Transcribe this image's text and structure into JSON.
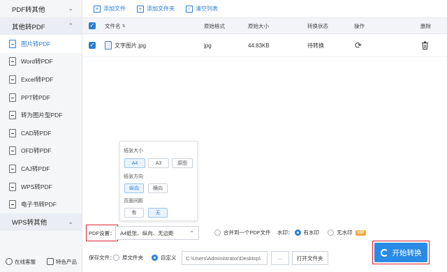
{
  "sidebar": {
    "group1": "PDF转其他",
    "group2": "其他转PDF",
    "group3": "WPS转其他",
    "items": [
      {
        "label": "图片转PDF"
      },
      {
        "label": "Word转PDF"
      },
      {
        "label": "Excel转PDF"
      },
      {
        "label": "PPT转PDF"
      },
      {
        "label": "转为图片型PDF"
      },
      {
        "label": "CAD转PDF"
      },
      {
        "label": "OFD转PDF"
      },
      {
        "label": "CAJ转PDF"
      },
      {
        "label": "WPS转PDF"
      },
      {
        "label": "电子书转PDF"
      }
    ],
    "footer": {
      "service": "在线客服",
      "products": "特色产品"
    }
  },
  "toolbar": {
    "add_file": "添加文件",
    "add_folder": "添加文件夹",
    "clear": "清空列表"
  },
  "table": {
    "headers": {
      "name": "文件名",
      "format": "原始格式",
      "size": "原始大小",
      "status": "转换状态",
      "action": "操作",
      "delete": "删除"
    },
    "rows": [
      {
        "name": "文字图片.jpg",
        "format": "jpg",
        "size": "44.83KB",
        "status": "待转换"
      }
    ]
  },
  "popup": {
    "paper_size_label": "纸张大小",
    "paper_sizes": [
      "A4",
      "A3",
      "原图"
    ],
    "orientation_label": "纸张方向",
    "orientations": [
      "纵向",
      "横向"
    ],
    "margin_label": "页面间距",
    "margins": [
      "有",
      "无"
    ]
  },
  "settings": {
    "pdf_label": "PDF设置：",
    "pdf_value": "A4纸张、纵向、无边距",
    "merge_label": "合并到一个PDF文件",
    "watermark_label": "水印：",
    "with_watermark": "有水印",
    "no_watermark": "无水印",
    "vip": "VIP",
    "save_label": "保存文件：",
    "original_folder": "原文件夹",
    "custom": "自定义",
    "path": "C:\\Users\\Administrator\\Desktop\\",
    "dots": "···",
    "open_folder": "打开文件夹",
    "start_button": "开始转换"
  },
  "colors": {
    "accent": "#2a8be6",
    "highlight": "#dd2233",
    "vip": "#f4a83a"
  }
}
